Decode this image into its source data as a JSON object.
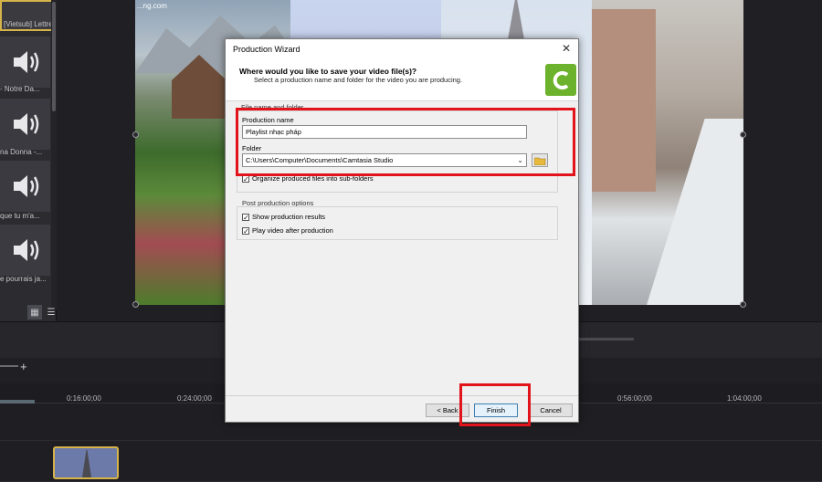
{
  "media_bin": {
    "items": [
      {
        "label": "[Vietsub] Lettre à ..."
      },
      {
        "label": "- Notre Da..."
      },
      {
        "label": "na Donna -..."
      },
      {
        "label": "que tu m'a..."
      },
      {
        "label": "e pourrais ja..."
      }
    ]
  },
  "canvas": {
    "watermark": "...ng.com"
  },
  "timeline": {
    "ticks": [
      "0:16:00;00",
      "0:24:00;00",
      "0:56:00;00",
      "1:04:00;00"
    ],
    "zoom_plus": "+"
  },
  "dialog": {
    "title": "Production Wizard",
    "close_glyph": "✕",
    "heading": "Where would you like to save your video file(s)?",
    "subheading": "Select a production name and folder for the video you are producing.",
    "file_group_label": "File name and folder",
    "production_name_label": "Production name",
    "production_name_value": "Playlist nhạc pháp",
    "folder_label": "Folder",
    "folder_value": "C:\\Users\\Computer\\Documents\\Camtasia Studio",
    "organize_label": "Organize produced files into sub-folders",
    "organize_checked": true,
    "post_group_label": "Post production options",
    "show_results_label": "Show production results",
    "show_results_checked": true,
    "play_video_label": "Play video after production",
    "play_video_checked": true,
    "back_button": "< Back",
    "finish_button": "Finish",
    "cancel_button": "Cancel"
  },
  "colors": {
    "highlight_red": "#e2131a",
    "camtasia_green": "#6cb22c",
    "clip_selected": "#d6b44a"
  }
}
